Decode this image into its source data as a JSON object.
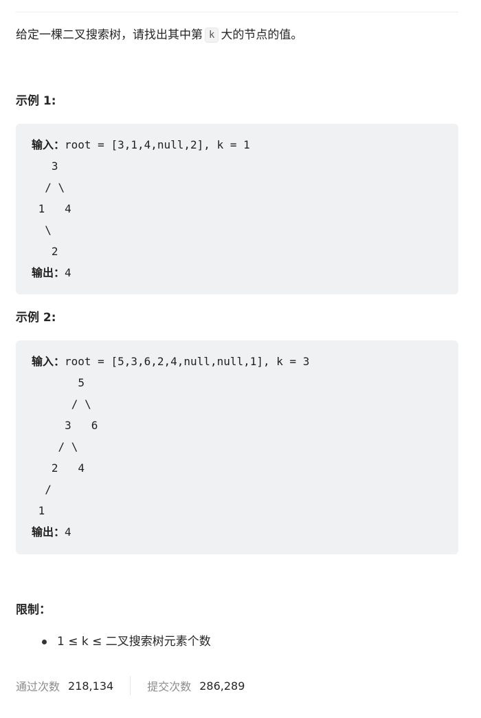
{
  "intro": {
    "before": "给定一棵二叉搜索树，请找出其中第",
    "code": "k",
    "after": "大的节点的值。"
  },
  "examples": [
    {
      "heading": "示例 1:",
      "input_label": "输入：",
      "input_value": "root = [3,1,4,null,2], k = 1",
      "tree_lines": [
        "   3",
        "  / \\",
        " 1   4",
        "  \\",
        "   2"
      ],
      "output_label": "输出：",
      "output_value": "4"
    },
    {
      "heading": "示例 2:",
      "input_label": "输入：",
      "input_value": "root = [5,3,6,2,4,null,null,1], k = 3",
      "tree_lines": [
        "       5",
        "      / \\",
        "     3   6",
        "    / \\",
        "   2   4",
        "  /",
        " 1"
      ],
      "output_label": "输出：",
      "output_value": "4"
    }
  ],
  "constraints": {
    "heading": "限制：",
    "items": [
      "1 ≤ k ≤ 二叉搜索树元素个数"
    ]
  },
  "stats": {
    "accepted_label": "通过次数",
    "accepted_value": "218,134",
    "submitted_label": "提交次数",
    "submitted_value": "286,289"
  }
}
